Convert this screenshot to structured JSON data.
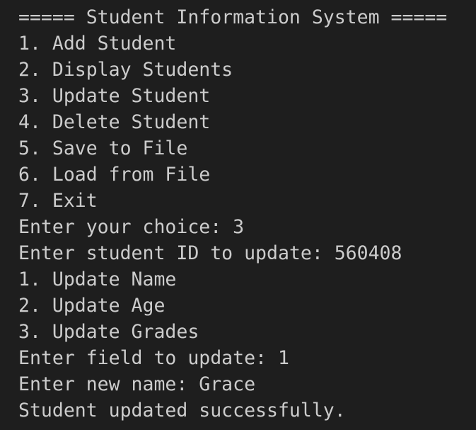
{
  "terminal": {
    "lines": [
      "===== Student Information System =====",
      "1. Add Student",
      "2. Display Students",
      "3. Update Student",
      "4. Delete Student",
      "5. Save to File",
      "6. Load from File",
      "7. Exit",
      "Enter your choice: 3",
      "Enter student ID to update: 560408",
      "1. Update Name",
      "2. Update Age",
      "3. Update Grades",
      "Enter field to update: 1",
      "Enter new name: Grace",
      "Student updated successfully."
    ]
  },
  "colors": {
    "background": "#1e1e1e",
    "text": "#cccccc"
  }
}
